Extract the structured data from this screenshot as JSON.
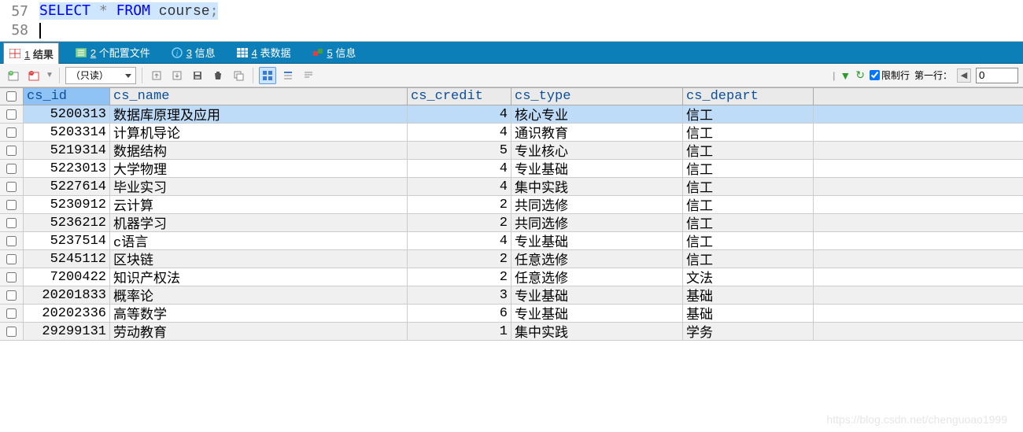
{
  "editor": {
    "line1_num": "57",
    "line2_num": "58",
    "sql_select": "SELECT",
    "sql_star": "*",
    "sql_from": "FROM",
    "sql_table": "course",
    "sql_semi": ";"
  },
  "tabs": {
    "t1": {
      "num": "1",
      "label": "结果"
    },
    "t2": {
      "num": "2",
      "label": "个配置文件"
    },
    "t3": {
      "num": "3",
      "label": "信息"
    },
    "t4": {
      "num": "4",
      "label": "表数据"
    },
    "t5": {
      "num": "5",
      "label": "信息"
    }
  },
  "toolbar": {
    "readonly": "（只读）",
    "limit_label": "限制行",
    "first_row_label": "第一行：",
    "first_row_value": "0"
  },
  "columns": {
    "c0": "cs_id",
    "c1": "cs_name",
    "c2": "cs_credit",
    "c3": "cs_type",
    "c4": "cs_depart"
  },
  "rows": [
    {
      "id": "5200313",
      "name": "数据库原理及应用",
      "credit": "4",
      "type": "核心专业",
      "depart": "信工"
    },
    {
      "id": "5203314",
      "name": "计算机导论",
      "credit": "4",
      "type": "通识教育",
      "depart": "信工"
    },
    {
      "id": "5219314",
      "name": "数据结构",
      "credit": "5",
      "type": "专业核心",
      "depart": "信工"
    },
    {
      "id": "5223013",
      "name": "大学物理",
      "credit": "4",
      "type": "专业基础",
      "depart": "信工"
    },
    {
      "id": "5227614",
      "name": "毕业实习",
      "credit": "4",
      "type": "集中实践",
      "depart": "信工"
    },
    {
      "id": "5230912",
      "name": "云计算",
      "credit": "2",
      "type": "共同选修",
      "depart": "信工"
    },
    {
      "id": "5236212",
      "name": "机器学习",
      "credit": "2",
      "type": "共同选修",
      "depart": "信工"
    },
    {
      "id": "5237514",
      "name": "c语言",
      "credit": "4",
      "type": "专业基础",
      "depart": "信工"
    },
    {
      "id": "5245112",
      "name": "区块链",
      "credit": "2",
      "type": "任意选修",
      "depart": "信工"
    },
    {
      "id": "7200422",
      "name": "知识产权法",
      "credit": "2",
      "type": "任意选修",
      "depart": "文法"
    },
    {
      "id": "20201833",
      "name": "概率论",
      "credit": "3",
      "type": "专业基础",
      "depart": "基础"
    },
    {
      "id": "20202336",
      "name": "高等数学",
      "credit": "6",
      "type": "专业基础",
      "depart": "基础"
    },
    {
      "id": "29299131",
      "name": "劳动教育",
      "credit": "1",
      "type": "集中实践",
      "depart": "学务"
    }
  ],
  "watermark": "https://blog.csdn.net/chenguoao1999"
}
